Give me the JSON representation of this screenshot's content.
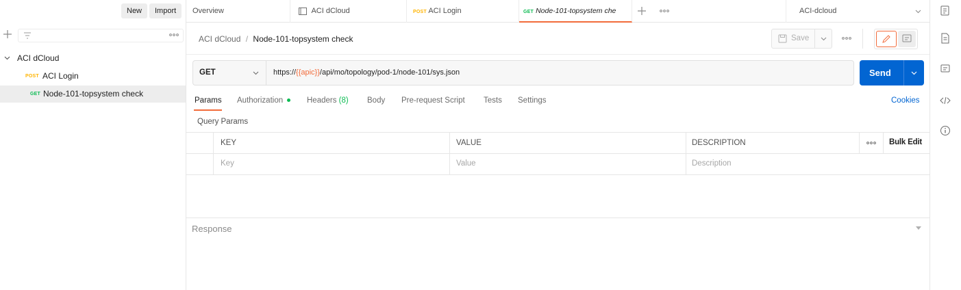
{
  "sidebar": {
    "new_label": "New",
    "import_label": "Import",
    "collection_name": "ACI dCloud",
    "requests": [
      {
        "method": "POST",
        "name": "ACI Login"
      },
      {
        "method": "GET",
        "name": "Node-101-topsystem check"
      }
    ]
  },
  "tabs": [
    {
      "label": "Overview"
    },
    {
      "label": "ACI dCloud"
    },
    {
      "method": "POST",
      "label": "ACI Login"
    },
    {
      "method": "GET",
      "label": "Node-101-topsystem che"
    }
  ],
  "environment": {
    "selected": "ACI-dcloud"
  },
  "breadcrumb": {
    "parent": "ACI dCloud",
    "separator": "/",
    "current": "Node-101-topsystem check"
  },
  "toolbar": {
    "save_label": "Save"
  },
  "request": {
    "method": "GET",
    "url_prefix": "https://",
    "url_variable": "{{apic}}",
    "url_suffix": "/api/mo/topology/pod-1/node-101/sys.json",
    "send_label": "Send"
  },
  "subtabs": {
    "params": "Params",
    "authorization": "Authorization",
    "headers": "Headers",
    "headers_count": "(8)",
    "body": "Body",
    "prerequest": "Pre-request Script",
    "tests": "Tests",
    "settings": "Settings",
    "cookies": "Cookies"
  },
  "params": {
    "title": "Query Params",
    "columns": {
      "key": "KEY",
      "value": "VALUE",
      "description": "DESCRIPTION"
    },
    "bulk_edit": "Bulk Edit",
    "placeholders": {
      "key": "Key",
      "value": "Value",
      "description": "Description"
    }
  },
  "response": {
    "label": "Response"
  },
  "colors": {
    "accent": "#0265d2",
    "get": "#0cbb52",
    "post": "#ffb400",
    "variable": "#f26b3a",
    "active_tab": "#f26b3a"
  }
}
